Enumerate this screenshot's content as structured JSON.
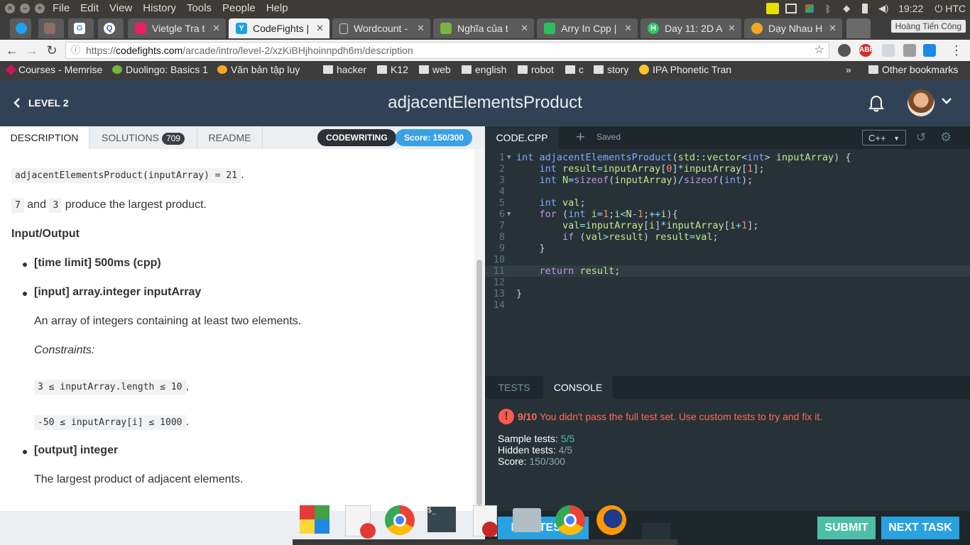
{
  "os": {
    "menu": [
      "File",
      "Edit",
      "View",
      "History",
      "Tools",
      "People",
      "Help"
    ],
    "time": "19:22",
    "user": "HTC"
  },
  "browser": {
    "tabs": [
      {
        "label": "Vietgle Tra t",
        "icon": "music-icon",
        "color": "#e91e63"
      },
      {
        "label": "CodeFights |",
        "icon": "codefights-icon",
        "color": "#1ba1e2",
        "active": true
      },
      {
        "label": "Wordcount -",
        "icon": "document-icon",
        "color": "#9e9e9e"
      },
      {
        "label": "Nghĩa của t",
        "icon": "puzzle-icon",
        "color": "#7cb342"
      },
      {
        "label": "Arry In Cpp |",
        "icon": "evernote-icon",
        "color": "#2dbe60"
      },
      {
        "label": "Day 11: 2D A",
        "icon": "hackerrank-icon",
        "color": "#2ec866"
      },
      {
        "label": "Dạy Nhau H",
        "icon": "face-icon",
        "color": "#f5a623"
      }
    ],
    "profile_name": "Hoàng Tiến Công",
    "url_scheme": "https://",
    "url_host": "codefights.com",
    "url_path": "/arcade/intro/level-2/xzKiBHjhoinnpdh6m/description",
    "bookmarks": [
      {
        "label": "Courses - Memrise",
        "icon": "memrise-icon"
      },
      {
        "label": "Duolingo: Basics 1",
        "icon": "duolingo-icon"
      },
      {
        "label": "Văn bản tập luy",
        "icon": "bookmark-icon"
      },
      {
        "label": "hacker",
        "icon": "folder-icon"
      },
      {
        "label": "K12",
        "icon": "folder-icon"
      },
      {
        "label": "web",
        "icon": "folder-icon"
      },
      {
        "label": "english",
        "icon": "folder-icon"
      },
      {
        "label": "robot",
        "icon": "folder-icon"
      },
      {
        "label": "c",
        "icon": "folder-icon"
      },
      {
        "label": "story",
        "icon": "folder-icon"
      },
      {
        "label": "IPA Phonetic Tran",
        "icon": "coin-icon"
      }
    ],
    "overflow": "»",
    "other_bookmarks": "Other bookmarks"
  },
  "header": {
    "back_label": "LEVEL 2",
    "title": "adjacentElementsProduct"
  },
  "left": {
    "tabs": {
      "description": "DESCRIPTION",
      "solutions": "SOLUTIONS",
      "solutions_count": "709",
      "readme": "README"
    },
    "mode_badge": "CODEWRITING",
    "score_badge": "Score: 150/300",
    "example_code": "adjacentElementsProduct(inputArray) = 21",
    "example_suffix": ".",
    "explain_a": "7",
    "explain_and": "and",
    "explain_b": "3",
    "explain_rest": "produce the largest product.",
    "io_heading": "Input/Output",
    "time_limit": "[time limit] 500ms (cpp)",
    "input_label": "[input] array.integer inputArray",
    "input_desc": "An array of integers containing at least two elements.",
    "constraints_label": "Constraints:",
    "constraint1": "3 ≤ inputArray.length ≤ 10",
    "constraint1_suffix": ",",
    "constraint2": "-50 ≤ inputArray[i] ≤ 1000",
    "constraint2_suffix": ".",
    "output_label": "[output] integer",
    "output_desc": "The largest product of adjacent elements."
  },
  "editor": {
    "file_tab": "CODE.CPP",
    "saved": "Saved",
    "language": "C++",
    "lines": [
      "int adjacentElementsProduct(std::vector<int> inputArray) {",
      "    int result=inputArray[0]*inputArray[1];",
      "    int N=sizeof(inputArray)/sizeof(int);",
      "",
      "    int val;",
      "    for (int i=1;i<N-1;++i){",
      "        val=inputArray[i]*inputArray[i+1];",
      "        if (val>result) result=val;",
      "    }",
      "",
      "    return result;",
      "",
      "}",
      ""
    ],
    "highlight_line": 11
  },
  "console": {
    "tabs": {
      "tests": "TESTS",
      "console": "CONSOLE"
    },
    "error_count": "9/10",
    "error_msg": "You didn't pass the full test set. Use custom tests to try and fix it.",
    "sample_label": "Sample tests:",
    "sample_value": "5/5",
    "hidden_label": "Hidden tests:",
    "hidden_value": "4/5",
    "score_label": "Score:",
    "score_value": "150/300"
  },
  "buttons": {
    "run_tests": "RUN TESTS",
    "submit": "SUBMIT",
    "next_task": "NEXT TASK"
  },
  "colors": {
    "header_bg": "#324256",
    "editor_bg": "#263238",
    "submit": "#4dbfa8",
    "next_task": "#2aa1e0",
    "error": "#ff6b57",
    "score_badge": "#3aa1e5"
  }
}
